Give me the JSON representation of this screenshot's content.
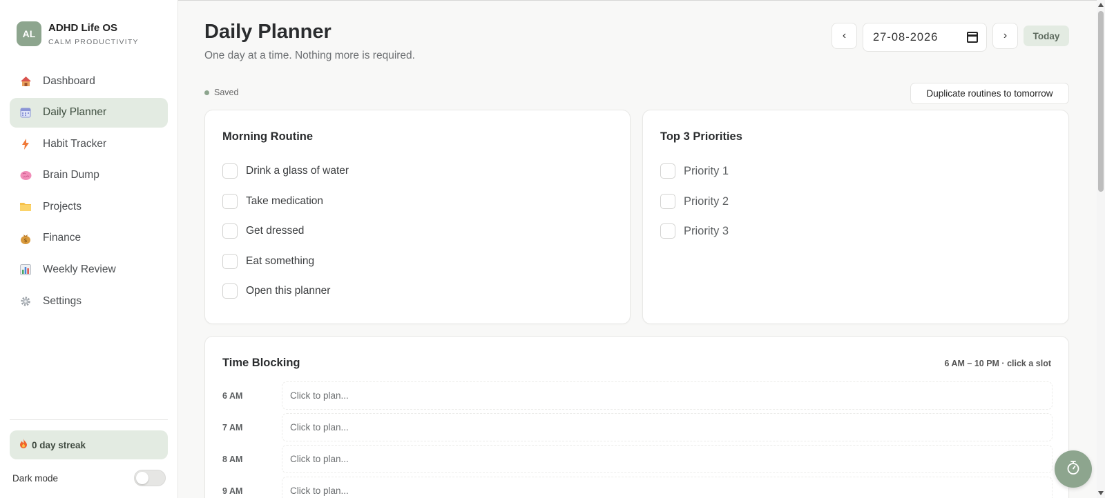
{
  "brand": {
    "initials": "AL",
    "title": "ADHD Life OS",
    "subtitle": "CALM PRODUCTIVITY"
  },
  "sidebar": {
    "items": [
      {
        "label": "Dashboard",
        "icon": "house-icon"
      },
      {
        "label": "Daily Planner",
        "icon": "calendar-icon",
        "active": true
      },
      {
        "label": "Habit Tracker",
        "icon": "lightning-icon"
      },
      {
        "label": "Brain Dump",
        "icon": "brain-icon"
      },
      {
        "label": "Projects",
        "icon": "folder-icon"
      },
      {
        "label": "Finance",
        "icon": "money-bag-icon"
      },
      {
        "label": "Weekly Review",
        "icon": "bar-chart-icon"
      },
      {
        "label": "Settings",
        "icon": "gear-icon"
      }
    ],
    "streak_label": "0 day streak",
    "dark_mode_label": "Dark mode",
    "dark_mode_on": false
  },
  "header": {
    "title": "Daily Planner",
    "subtitle": "One day at a time. Nothing more is required.",
    "prev_label": "‹",
    "next_label": "›",
    "date_value": "27-08-2026",
    "today_label": "Today"
  },
  "status": {
    "saved_label": "Saved",
    "duplicate_label": "Duplicate routines to tomorrow"
  },
  "morning_routine": {
    "title": "Morning Routine",
    "items": [
      "Drink a glass of water",
      "Take medication",
      "Get dressed",
      "Eat something",
      "Open this planner"
    ]
  },
  "priorities": {
    "title": "Top 3 Priorities",
    "items": [
      "Priority 1",
      "Priority 2",
      "Priority 3"
    ]
  },
  "time_blocking": {
    "title": "Time Blocking",
    "hint": "6 AM – 10 PM · click a slot",
    "slot_placeholder": "Click to plan...",
    "slots": [
      "6 AM",
      "7 AM",
      "8 AM",
      "9 AM"
    ]
  },
  "colors": {
    "accent": "#8da58e",
    "accent_light": "#e3ebe2",
    "background": "#f8f8f7"
  }
}
